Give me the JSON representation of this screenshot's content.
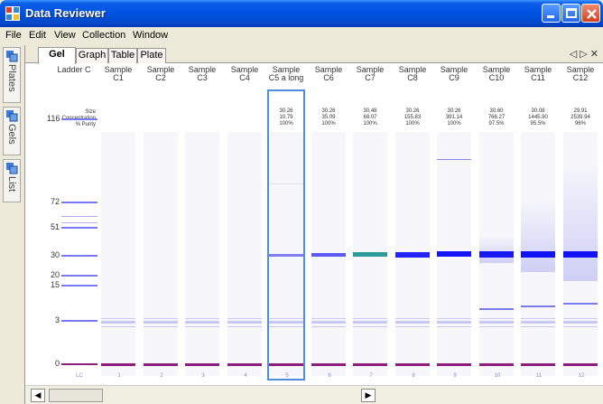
{
  "window": {
    "title": "Data Reviewer"
  },
  "menu": [
    "File",
    "Edit",
    "View",
    "Collection",
    "Window"
  ],
  "side_tabs": [
    "Plates",
    "Gels",
    "List"
  ],
  "doc_tabs": [
    "Gel",
    "Graph",
    "Table",
    "Plate"
  ],
  "nav_arrows": "◁ ▷ ✕",
  "gel": {
    "ladder_header": "Ladder C",
    "stats_labels": [
      "Size",
      "Concentration",
      "% Purity"
    ],
    "samples": [
      {
        "line1": "Sample",
        "line2": "C1",
        "size": "",
        "conc": "",
        "purity": "",
        "num": "1"
      },
      {
        "line1": "Sample",
        "line2": "C2",
        "size": "",
        "conc": "",
        "purity": "",
        "num": "2"
      },
      {
        "line1": "Sample",
        "line2": "C3",
        "size": "",
        "conc": "",
        "purity": "",
        "num": "3"
      },
      {
        "line1": "Sample",
        "line2": "C4",
        "size": "",
        "conc": "",
        "purity": "",
        "num": "4"
      },
      {
        "line1": "Sample",
        "line2": "C5 a long",
        "size": "30.26",
        "conc": "10.79",
        "purity": "100%",
        "num": "5"
      },
      {
        "line1": "Sample",
        "line2": "C6",
        "size": "30.26",
        "conc": "35.09",
        "purity": "100%",
        "num": "6"
      },
      {
        "line1": "Sample",
        "line2": "C7",
        "size": "30.48",
        "conc": "68.07",
        "purity": "100%",
        "num": "7"
      },
      {
        "line1": "Sample",
        "line2": "C8",
        "size": "30.26",
        "conc": "155.83",
        "purity": "100%",
        "num": "8"
      },
      {
        "line1": "Sample",
        "line2": "C9",
        "size": "30.26",
        "conc": "391.14",
        "purity": "100%",
        "num": "9"
      },
      {
        "line1": "Sample",
        "line2": "C10",
        "size": "30.60",
        "conc": "766.27",
        "purity": "97.5%",
        "num": "10"
      },
      {
        "line1": "Sample",
        "line2": "C11",
        "size": "30.08",
        "conc": "1445.90",
        "purity": "95.5%",
        "num": "11"
      },
      {
        "line1": "Sample",
        "line2": "C12",
        "size": "29.91",
        "conc": "2539.94",
        "purity": "96%",
        "num": "12"
      }
    ],
    "ladder_num": "LC",
    "ladder_sizes": [
      "116",
      "72",
      "51",
      "30",
      "20",
      "15",
      "3",
      "0"
    ],
    "selected_lane": "5"
  },
  "colors": {
    "ladder_band": "#7a7af0",
    "marker_band": "#8e1e7e",
    "selection": "#4f8fd8",
    "title_bar": "#0052e0"
  }
}
